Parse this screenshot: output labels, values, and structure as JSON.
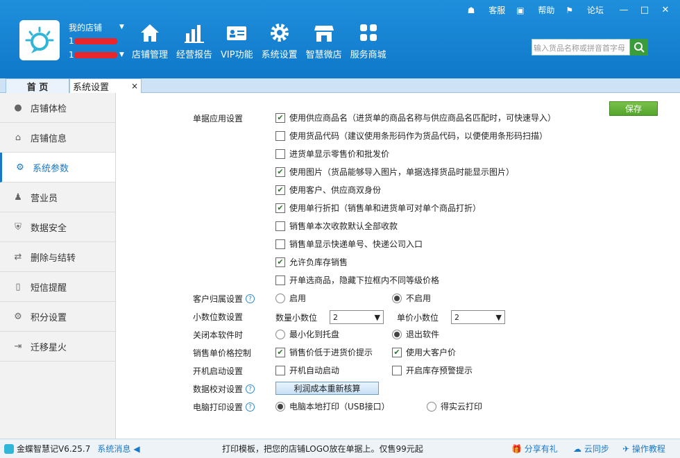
{
  "shop": {
    "name": "我的店铺",
    "phone1": "1",
    "phone2": "1"
  },
  "nav": [
    "店铺管理",
    "经营报告",
    "VIP功能",
    "系统设置",
    "智慧微店",
    "服务商城"
  ],
  "topright": {
    "service": "客服",
    "help": "帮助",
    "forum": "论坛"
  },
  "search": {
    "placeholder": "输入货品名称或拼音首字母"
  },
  "tabs": {
    "home": "首 页",
    "settings": "系统设置",
    "close": "×"
  },
  "sidebar": [
    "店铺体检",
    "店铺信息",
    "系统参数",
    "营业员",
    "数据安全",
    "删除与结转",
    "短信提醒",
    "积分设置",
    "迁移星火"
  ],
  "save": "保存",
  "doc": {
    "title": "单据应用设置",
    "options": [
      {
        "label": "使用供应商品名（进货单的商品名称与供应商品名匹配时，可快速导入）",
        "checked": true
      },
      {
        "label": "使用货品代码（建议使用条形码作为货品代码，以便使用条形码扫描）",
        "checked": false
      },
      {
        "label": "进货单显示零售价和批发价",
        "checked": false
      },
      {
        "label": "使用图片（货品能够导入图片，单据选择货品时能显示图片）",
        "checked": true
      },
      {
        "label": "使用客户、供应商双身份",
        "checked": true
      },
      {
        "label": "使用单行折扣（销售单和进货单可对单个商品打折）",
        "checked": true
      },
      {
        "label": "销售单本次收款默认全部收款",
        "checked": false
      },
      {
        "label": "销售单显示快递单号、快递公司入口",
        "checked": false
      },
      {
        "label": "允许负库存销售",
        "checked": true
      },
      {
        "label": "开单选商品，隐藏下拉框内不同等级价格",
        "checked": false
      }
    ]
  },
  "customer": {
    "label": "客户归属设置",
    "on": "启用",
    "off": "不启用"
  },
  "decimal": {
    "label": "小数位数设置",
    "qty": "数量小数位",
    "qty_val": "2",
    "price": "单价小数位",
    "price_val": "2"
  },
  "close": {
    "label": "关闭本软件时",
    "tray": "最小化到托盘",
    "exit": "退出软件"
  },
  "price": {
    "label": "销售单价格控制",
    "low": "销售价低于进货价提示",
    "big": "使用大客户价"
  },
  "boot": {
    "label": "开机启动设置",
    "auto": "开机自动启动",
    "stock": "开启库存预警提示"
  },
  "check": {
    "label": "数据校对设置",
    "btn": "利润成本重新核算"
  },
  "print": {
    "label": "电脑打印设置",
    "local": "电脑本地打印（USB接口）",
    "cloud": "得实云打印"
  },
  "status": {
    "app": "金蝶智慧记V6.25.7",
    "msg": "系统消息",
    "notice": "打印模板，把您的店铺LOGO放在单据上。仅售99元起",
    "share": "分享有礼",
    "sync": "云同步",
    "guide": "操作教程"
  }
}
